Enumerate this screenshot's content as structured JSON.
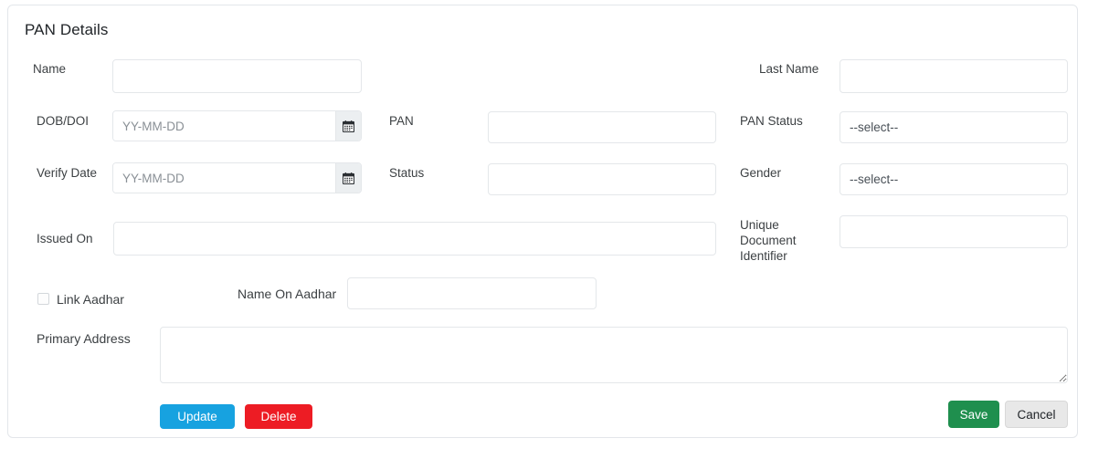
{
  "panel": {
    "title": "PAN Details"
  },
  "fields": {
    "name": {
      "label": "Name",
      "value": "",
      "placeholder": ""
    },
    "last_name": {
      "label": "Last Name",
      "value": "",
      "placeholder": ""
    },
    "dob_doi": {
      "label": "DOB/DOI",
      "value": "",
      "placeholder": "YY-MM-DD",
      "icon": "calendar-icon"
    },
    "pan": {
      "label": "PAN",
      "value": "",
      "placeholder": ""
    },
    "pan_status": {
      "label": "PAN Status",
      "value": "--select--",
      "options": [
        "--select--"
      ]
    },
    "verify_date": {
      "label": "Verify Date",
      "value": "",
      "placeholder": "YY-MM-DD",
      "icon": "calendar-icon"
    },
    "status": {
      "label": "Status",
      "value": "",
      "placeholder": ""
    },
    "gender": {
      "label": "Gender",
      "value": "--select--",
      "options": [
        "--select--"
      ]
    },
    "issued_on": {
      "label": "Issued On",
      "value": "",
      "placeholder": ""
    },
    "unique_document_identifier": {
      "label": "Unique Document Identifier",
      "value": "",
      "placeholder": ""
    },
    "link_aadhar": {
      "label": "Link Aadhar",
      "checked": false
    },
    "name_on_aadhar": {
      "label": "Name On Aadhar",
      "value": "",
      "placeholder": ""
    },
    "primary_address": {
      "label": "Primary Address",
      "value": "",
      "placeholder": ""
    }
  },
  "buttons": {
    "update": {
      "label": "Update",
      "color": "#17a2e0"
    },
    "delete": {
      "label": "Delete",
      "color": "#ed1c24"
    },
    "save": {
      "label": "Save",
      "color": "#1f8f4e"
    },
    "cancel": {
      "label": "Cancel",
      "color": "#e8e8e8"
    }
  }
}
